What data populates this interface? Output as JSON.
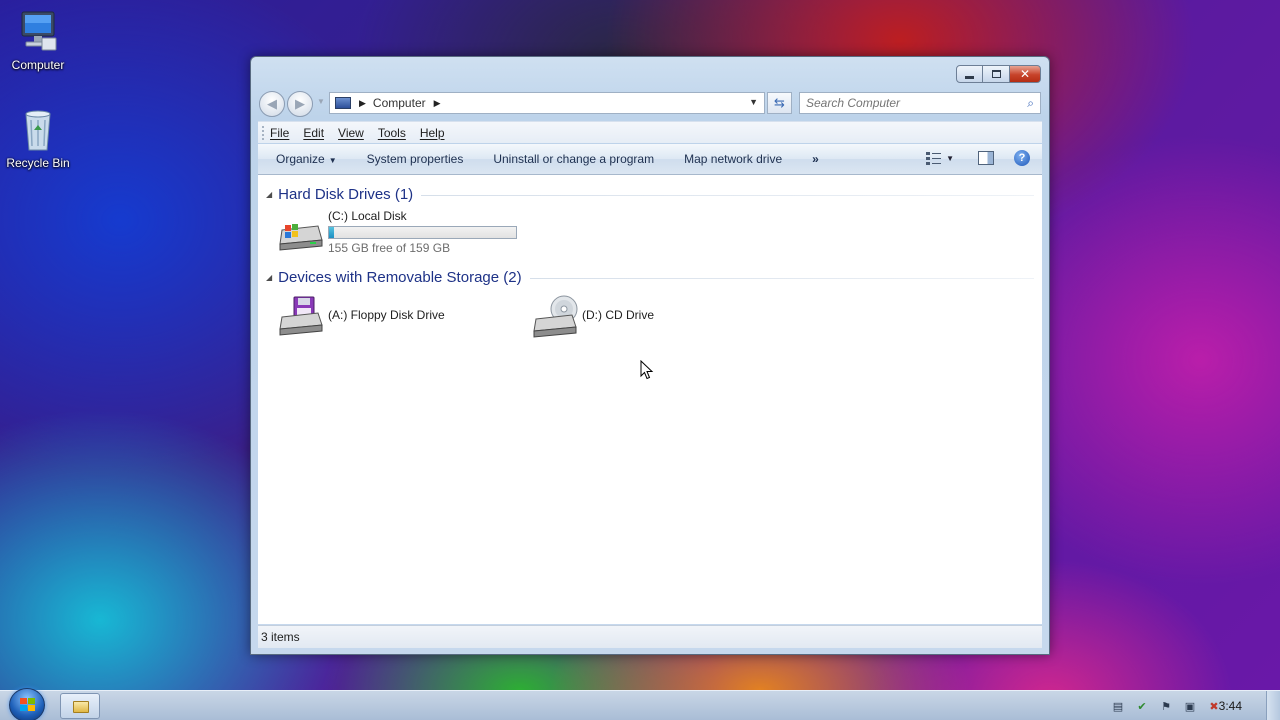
{
  "desktop": {
    "icons": [
      {
        "label": "Computer",
        "icon": "computer-icon"
      },
      {
        "label": "Recycle Bin",
        "icon": "recycle-bin-icon"
      }
    ]
  },
  "window": {
    "caption_buttons": {
      "minimize": "minimize-icon",
      "maximize": "maximize-icon",
      "close": "close-icon"
    },
    "address": {
      "crumb": "Computer"
    },
    "search": {
      "placeholder": "Search Computer"
    },
    "menu": [
      "File",
      "Edit",
      "View",
      "Tools",
      "Help"
    ],
    "commands": {
      "organize": "Organize",
      "system_properties": "System properties",
      "uninstall": "Uninstall or change a program",
      "map_drive": "Map network drive",
      "more": "»"
    },
    "groups": {
      "hdd": {
        "title": "Hard Disk Drives (1)",
        "drives": [
          {
            "name": "(C:) Local Disk",
            "free": "155 GB free of 159 GB",
            "used_fraction": 0.025
          }
        ]
      },
      "removable": {
        "title": "Devices with Removable Storage (2)",
        "drives": [
          {
            "name": "(A:) Floppy Disk Drive"
          },
          {
            "name": "(D:) CD Drive"
          }
        ]
      }
    },
    "status": {
      "items": "3 items"
    }
  },
  "taskbar": {
    "clock": "3:44",
    "tray_icons": [
      "action-center-icon",
      "security-icon",
      "flag-icon",
      "network-icon",
      "volume-muted-icon"
    ]
  },
  "colors": {
    "accent": "#1e3287",
    "close": "#c7432a",
    "progress": "#1c8fc2"
  }
}
